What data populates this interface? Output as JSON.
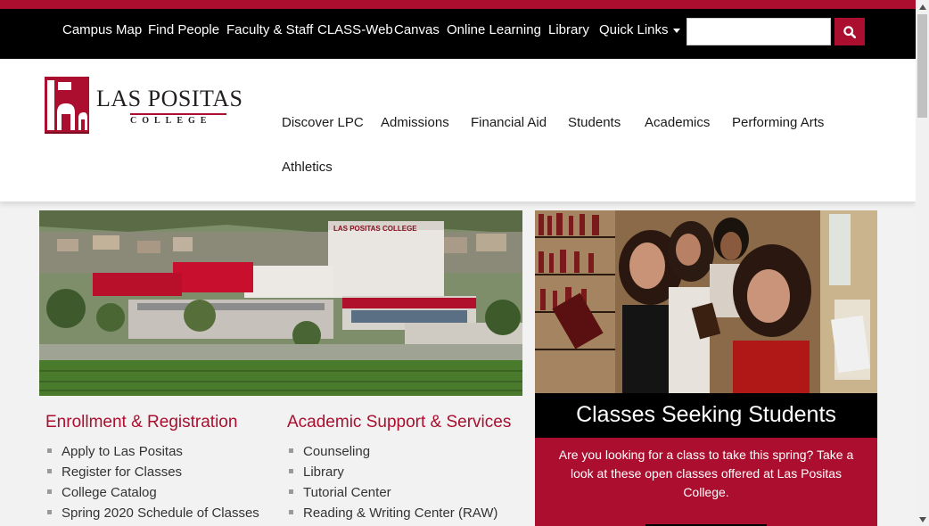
{
  "utility_nav": {
    "links": [
      "Campus Map",
      "Find People",
      "Faculty & Staff",
      "CLASS-Web",
      "Canvas",
      "Online Learning",
      "Library"
    ],
    "quick_links": "Quick Links",
    "search_placeholder": "",
    "search_icon": "search-icon"
  },
  "brand": {
    "name": "LAS POSITAS",
    "subname": "COLLEGE",
    "color_primary": "#ab0e2e"
  },
  "main_nav": {
    "items": [
      "Discover LPC",
      "Admissions",
      "Financial Aid",
      "Students",
      "Academics",
      "Performing Arts",
      "Athletics"
    ]
  },
  "hero": {
    "building_sign": "LAS POSITAS COLLEGE"
  },
  "enrollment": {
    "title": "Enrollment & Registration",
    "links": [
      "Apply to Las Positas",
      "Register for Classes",
      "College Catalog",
      "Spring 2020 Schedule of Classes"
    ]
  },
  "academic_support": {
    "title": "Academic Support & Services",
    "links": [
      "Counseling",
      "Library",
      "Tutorial Center",
      "Reading & Writing Center (RAW)"
    ]
  },
  "promo": {
    "title": "Classes Seeking Students",
    "text": "Are you looking for a class to take this spring? Take a look at these open classes offered at Las Positas College."
  }
}
